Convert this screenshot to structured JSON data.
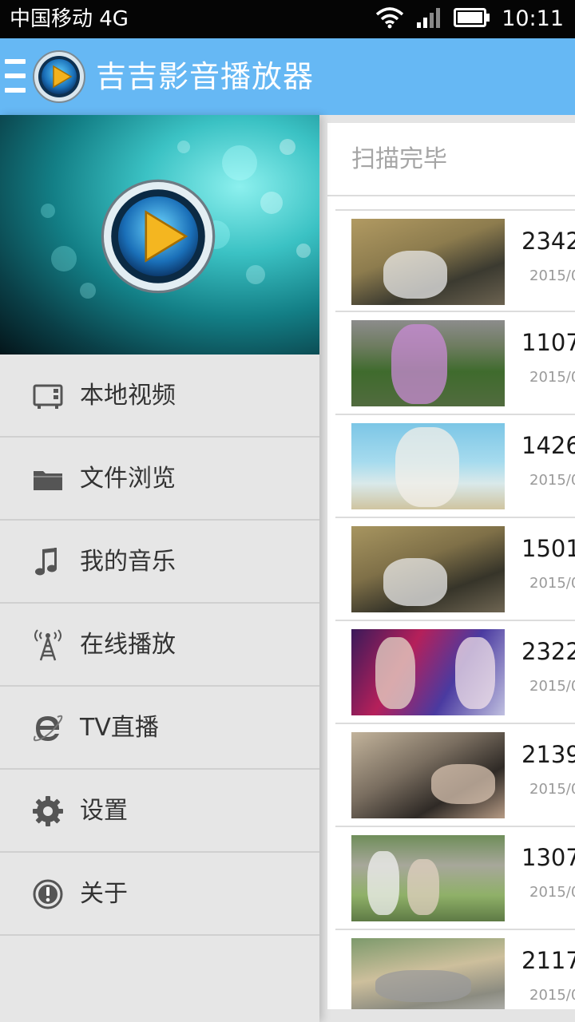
{
  "status_bar": {
    "carrier": "中国移动 4G",
    "time": "10:11"
  },
  "app_bar": {
    "title": "吉吉影音播放器",
    "accent_color": "#66b8f4"
  },
  "drawer": {
    "items": [
      {
        "label": "本地视频",
        "icon": "tv-icon"
      },
      {
        "label": "文件浏览",
        "icon": "folder-icon"
      },
      {
        "label": "我的音乐",
        "icon": "music-note-icon"
      },
      {
        "label": "在线播放",
        "icon": "antenna-tower-icon"
      },
      {
        "label": "TV直播",
        "icon": "ie-browser-icon"
      },
      {
        "label": "设置",
        "icon": "gear-icon"
      },
      {
        "label": "关于",
        "icon": "info-exclamation-icon"
      }
    ]
  },
  "content": {
    "scan_status": "扫描完毕",
    "videos": [
      {
        "title": "2342",
        "date": "2015/0"
      },
      {
        "title": "1107",
        "date": "2015/0"
      },
      {
        "title": "1426",
        "date": "2015/0"
      },
      {
        "title": "1501",
        "date": "2015/0"
      },
      {
        "title": "2322",
        "date": "2015/0"
      },
      {
        "title": "2139",
        "date": "2015/0"
      },
      {
        "title": "1307",
        "date": "2015/0"
      },
      {
        "title": "2117",
        "date": "2015/0"
      }
    ]
  }
}
